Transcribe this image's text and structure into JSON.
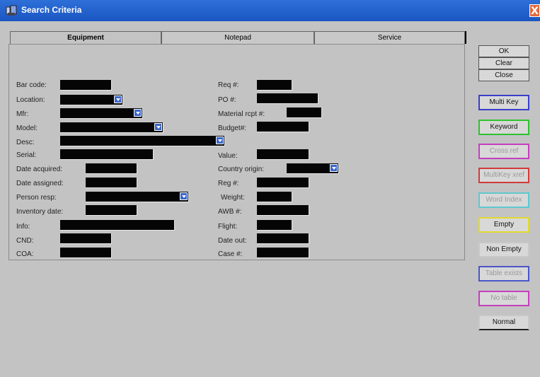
{
  "window": {
    "title": "Search Criteria",
    "close": "X"
  },
  "tabs": [
    "Equipment",
    "Notepad",
    "Service"
  ],
  "left_fields": [
    {
      "label": "Bar code:",
      "dropdown": false
    },
    {
      "label": "Location:",
      "dropdown": true
    },
    {
      "label": "Mfr:",
      "dropdown": true
    },
    {
      "label": "Model:",
      "dropdown": true
    },
    {
      "label": "Desc:",
      "dropdown": true
    },
    {
      "label": "Serial:",
      "dropdown": false
    },
    {
      "label": "Date acquired:",
      "dropdown": false
    },
    {
      "label": "Date assigned:",
      "dropdown": false
    },
    {
      "label": "Person resp:",
      "dropdown": true
    },
    {
      "label": "Inventory date:",
      "dropdown": false
    },
    {
      "label": "Info:",
      "dropdown": false
    },
    {
      "label": "CND:",
      "dropdown": false
    },
    {
      "label": "COA:",
      "dropdown": false
    }
  ],
  "right_fields": [
    {
      "label": "Req #:",
      "dropdown": false
    },
    {
      "label": "PO #:",
      "dropdown": false
    },
    {
      "label": "Material rcpt #:",
      "dropdown": false
    },
    {
      "label": "Budget#:",
      "dropdown": false
    },
    {
      "label": "Value:",
      "dropdown": false
    },
    {
      "label": "Country origin:",
      "dropdown": true
    },
    {
      "label": "Reg #:",
      "dropdown": false
    },
    {
      "label": "Weight:",
      "dropdown": false
    },
    {
      "label": "AWB #:",
      "dropdown": false
    },
    {
      "label": "Flight:",
      "dropdown": false
    },
    {
      "label": "Date out:",
      "dropdown": false
    },
    {
      "label": "Case #:",
      "dropdown": false
    }
  ],
  "buttons": {
    "ok": "OK",
    "clear": "Clear",
    "close": "Close",
    "multi_key": "Multi Key",
    "keyword": "Keyword",
    "cross_ref": "Cross ref",
    "multikey_xref": "MultiKey xref",
    "word_index": "Word Index",
    "empty": "Empty",
    "non_empty": "Non Empty",
    "table_exists": "Table exists",
    "no_table": "No table",
    "normal": "Normal"
  },
  "colors": {
    "titlebar": "#1b56c2",
    "multi_key": "#3a3fc9",
    "keyword": "#2fc22f",
    "cross_ref": "#c43fbf",
    "multikey_xref": "#d23a3a",
    "word_index": "#5ec8cf",
    "empty": "#e0da2f",
    "table_exists": "#4a55c9",
    "no_table": "#c43fbf",
    "input_fill": "#050505",
    "dropdown_arrow": "#3b67c9"
  }
}
